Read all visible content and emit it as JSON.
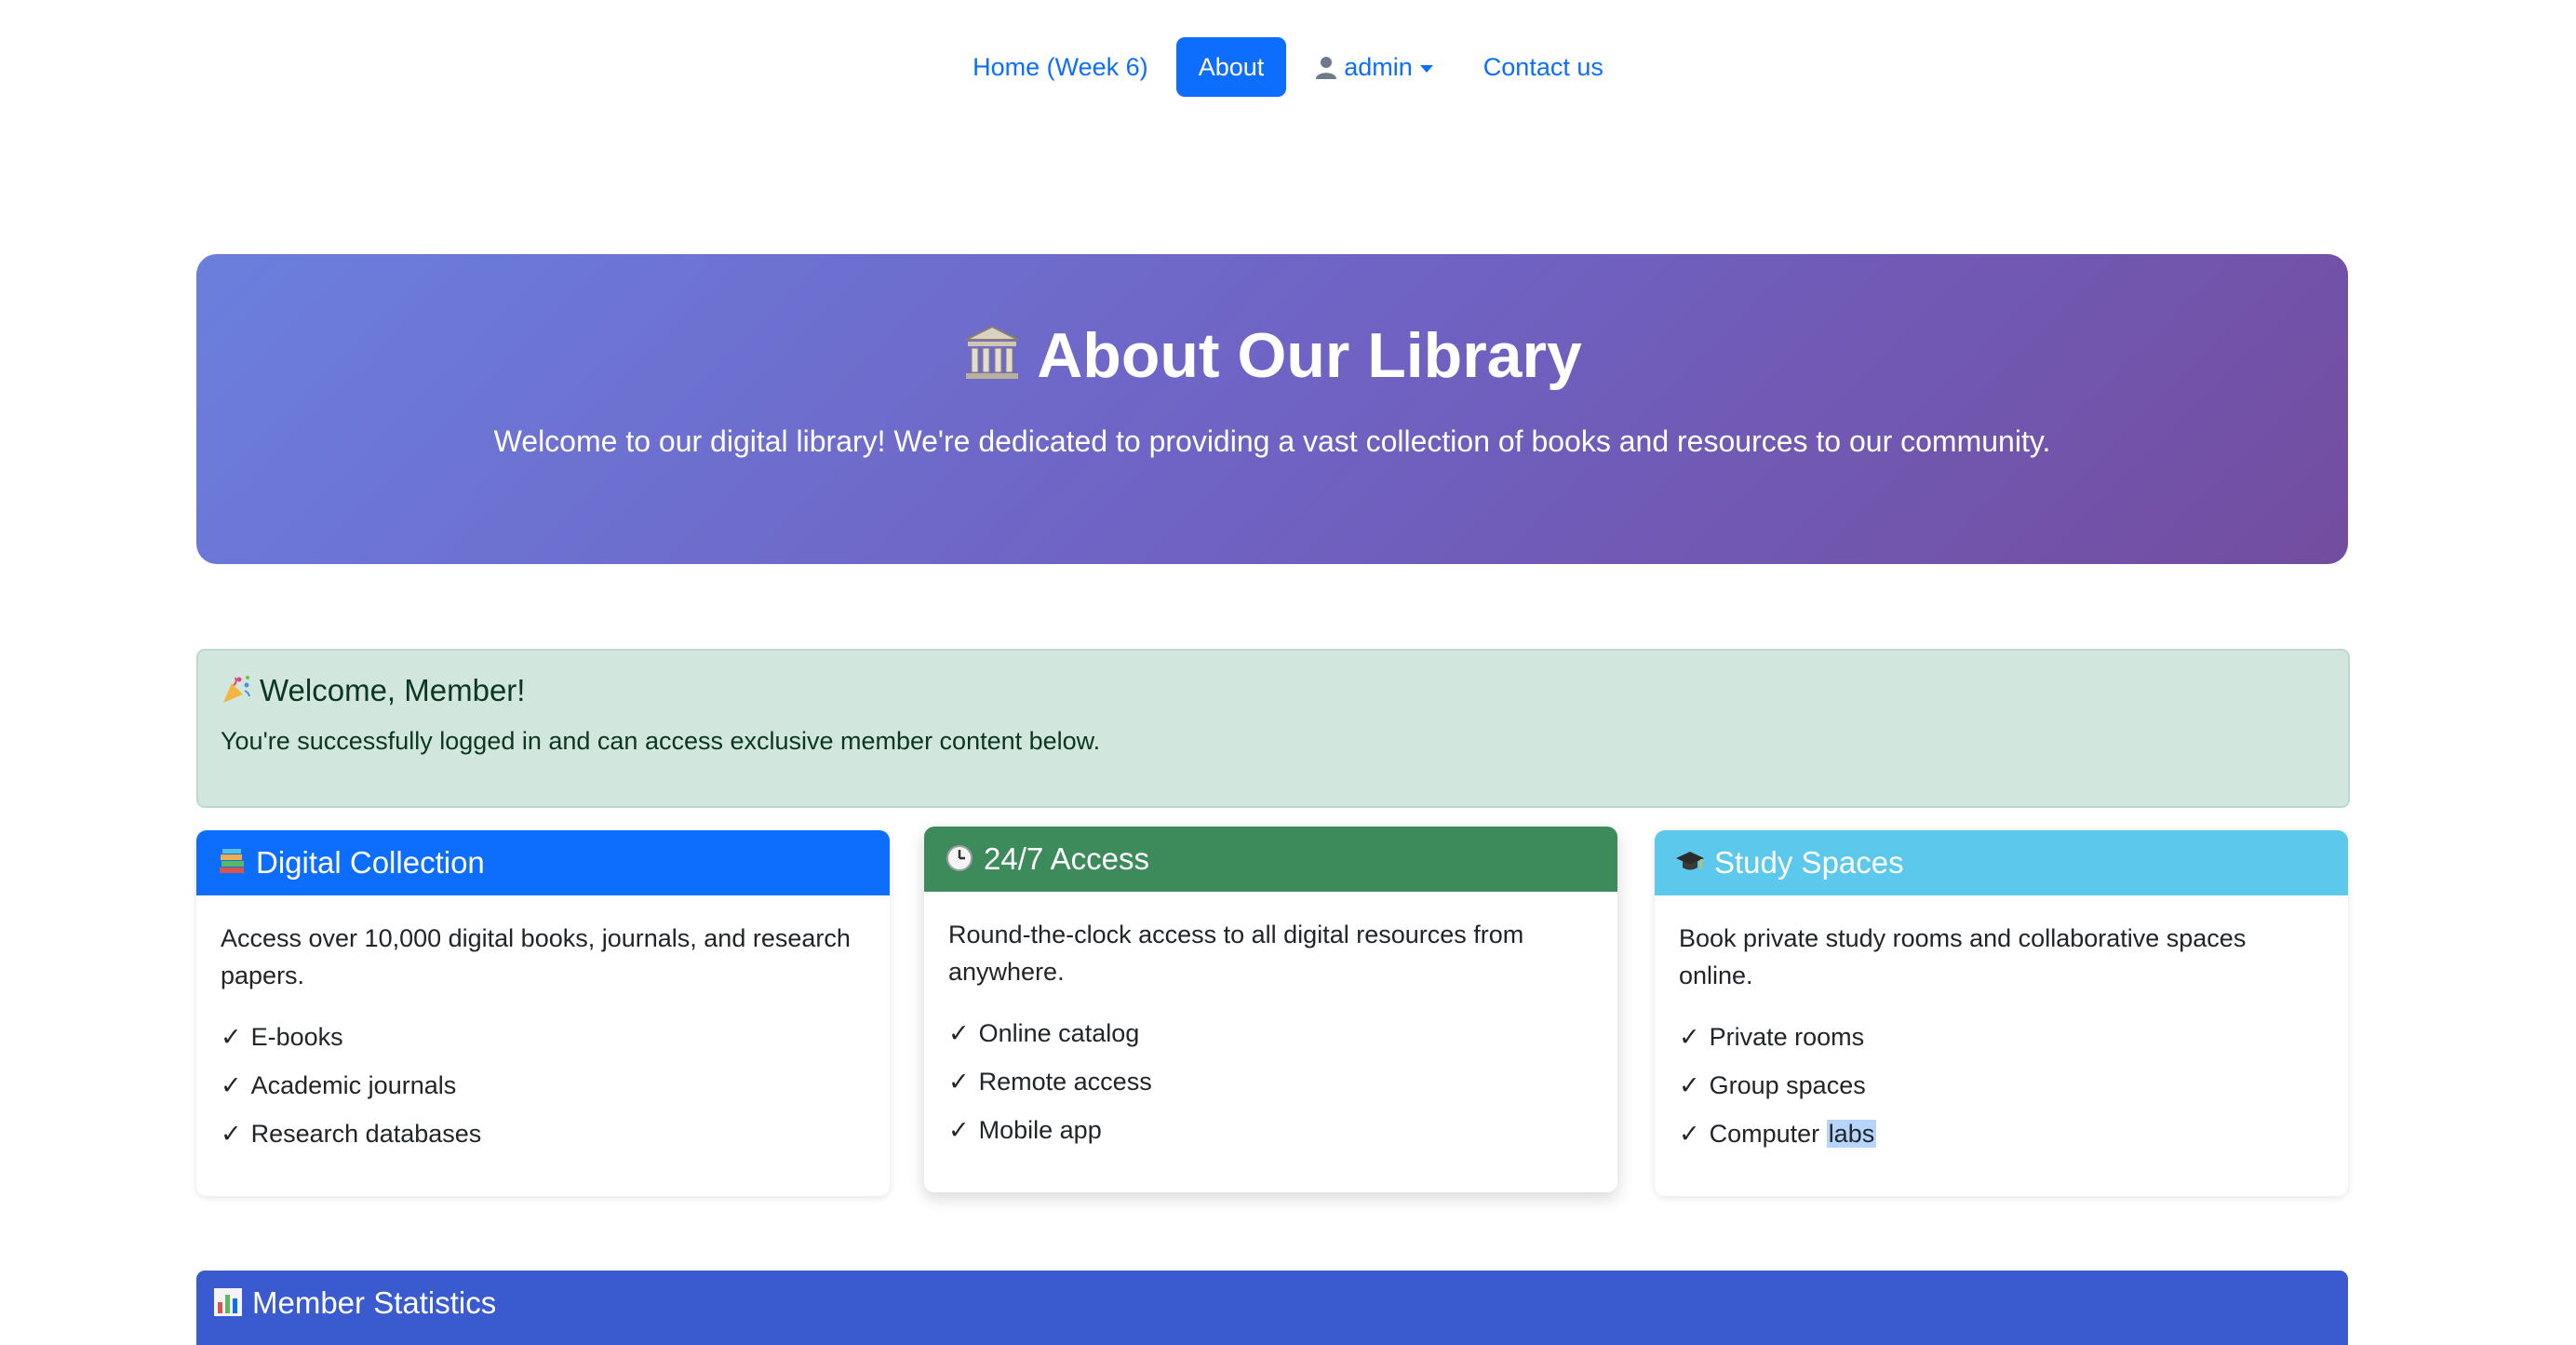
{
  "nav": {
    "home": "Home (Week 6)",
    "about": "About",
    "admin": "admin",
    "contact": "Contact us"
  },
  "hero": {
    "title": "About Our Library",
    "subtitle": "Welcome to our digital library! We're dedicated to providing a vast collection of books and resources to our community."
  },
  "alert": {
    "title": "Welcome, Member!",
    "text": "You're successfully logged in and can access exclusive member content below."
  },
  "cards": [
    {
      "title": "Digital Collection",
      "description": "Access over 10,000 digital books, journals, and research papers.",
      "items": [
        "E-books",
        "Academic journals",
        "Research databases"
      ],
      "color": "#0d6efd"
    },
    {
      "title": "24/7 Access",
      "description": "Round-the-clock access to all digital resources from anywhere.",
      "items": [
        "Online catalog",
        "Remote access",
        "Mobile app"
      ],
      "color": "#198754"
    },
    {
      "title": "Study Spaces",
      "description": "Book private study rooms and collaborative spaces online.",
      "items": [
        "Private rooms",
        "Group spaces"
      ],
      "last_item_prefix": "Computer ",
      "last_item_highlight": "labs",
      "color": "#0dcaf0"
    }
  ],
  "check": "✓",
  "stats": {
    "title": "Member Statistics"
  },
  "icons": {
    "user": "user-icon",
    "hero": "library-building-icon",
    "alert": "party-popper-icon",
    "card1": "books-icon",
    "card2": "clock-icon",
    "card3": "graduation-cap-icon",
    "stats": "bar-chart-icon"
  }
}
